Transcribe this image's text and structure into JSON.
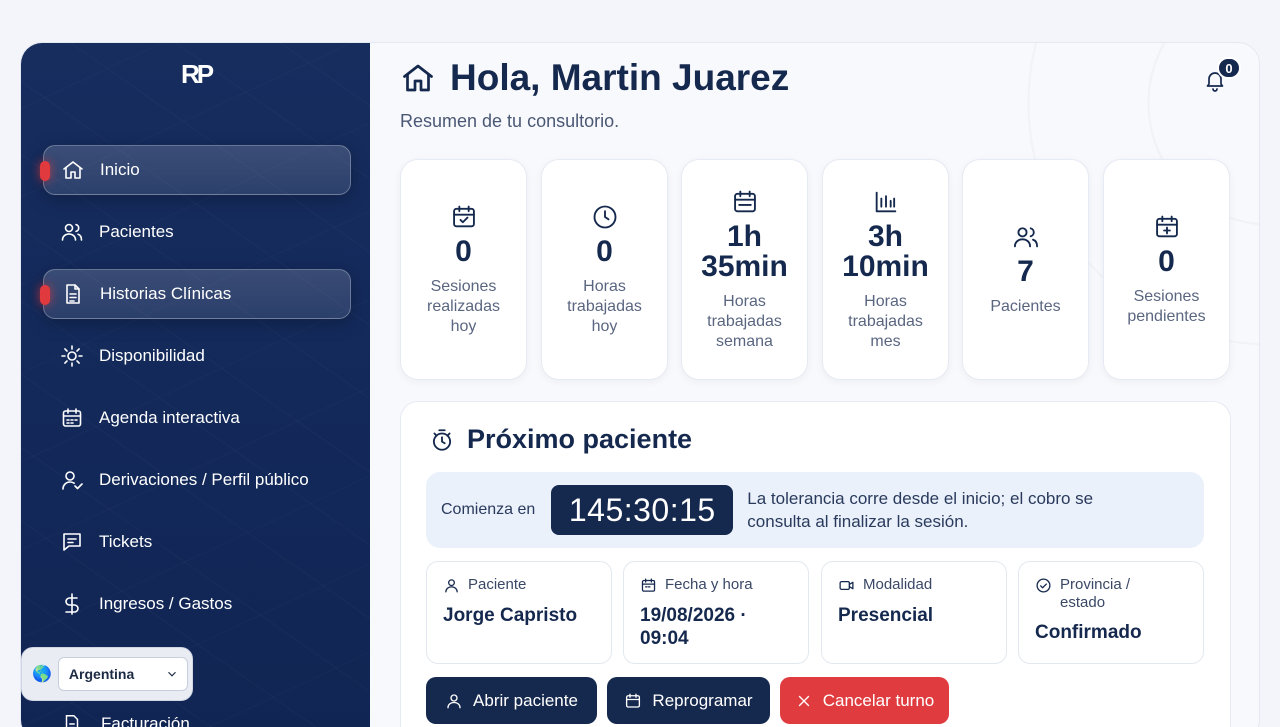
{
  "app": {
    "logo_text": "RP"
  },
  "sidebar": {
    "items": [
      {
        "label": "Inicio"
      },
      {
        "label": "Pacientes"
      },
      {
        "label": "Historias Clínicas"
      },
      {
        "label": "Disponibilidad"
      },
      {
        "label": "Agenda interactiva"
      },
      {
        "label": "Derivaciones / Perfil público"
      },
      {
        "label": "Tickets"
      },
      {
        "label": "Ingresos / Gastos"
      },
      {
        "label": "Facturación"
      }
    ],
    "country": {
      "selected": "Argentina",
      "icon": "globe-icon"
    }
  },
  "header": {
    "title": "Hola, Martin Juarez",
    "subtitle": "Resumen de tu consultorio.",
    "notifications_count": "0"
  },
  "stats": [
    {
      "value": "0",
      "label": "Sesiones realizadas hoy",
      "icon": "calendar-check-icon"
    },
    {
      "value": "0",
      "label": "Horas trabajadas hoy",
      "icon": "clock-icon"
    },
    {
      "value": "1h 35min",
      "label": "Horas trabajadas semana",
      "icon": "calendar-week-icon"
    },
    {
      "value": "3h 10min",
      "label": "Horas trabajadas mes",
      "icon": "bar-chart-icon"
    },
    {
      "value": "7",
      "label": "Pacientes",
      "icon": "users-icon"
    },
    {
      "value": "0",
      "label": "Sesiones pendientes",
      "icon": "calendar-plus-icon"
    }
  ],
  "next_patient": {
    "title": "Próximo paciente",
    "countdown_label": "Comienza en",
    "countdown": "145:30:15",
    "note": "La tolerancia corre desde el inicio; el cobro se consulta al finalizar la sesión.",
    "fields": [
      {
        "label": "Paciente",
        "value": "Jorge Capristo"
      },
      {
        "label": "Fecha y hora",
        "value": "19/08/2026 · 09:04"
      },
      {
        "label": "Modalidad",
        "value": "Presencial"
      },
      {
        "label": "Provincia / estado",
        "value": "Confirmado"
      }
    ],
    "buttons": {
      "open": "Abrir paciente",
      "reschedule": "Reprogramar",
      "cancel": "Cancelar turno"
    }
  },
  "colors": {
    "navy": "#15284d",
    "danger": "#e03c3f",
    "accent_light": "#eaf1fb"
  }
}
